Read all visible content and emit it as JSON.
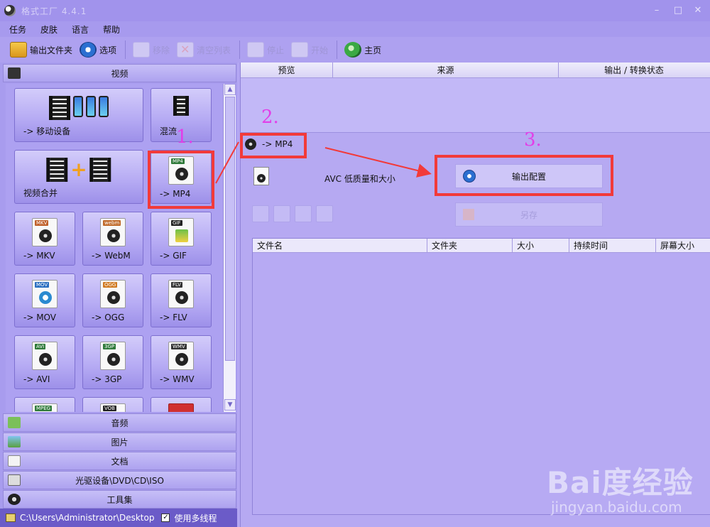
{
  "window": {
    "title": "格式工厂 4.4.1",
    "controls": [
      "–",
      "□",
      "✕"
    ]
  },
  "menu": [
    "任务",
    "皮肤",
    "语言",
    "帮助"
  ],
  "toolbar": {
    "output_folder": "输出文件夹",
    "options": "选项",
    "remove": "移除",
    "clear_list": "清空列表",
    "stop": "停止",
    "start": "开始",
    "home": "主页"
  },
  "left": {
    "video_header": "视频",
    "tiles": [
      {
        "label": "-> 移动设备"
      },
      {
        "label": "混流"
      },
      {
        "label": "视频合并"
      },
      {
        "label": "-> MP4",
        "badge": "MP4",
        "badge_color": "#2f7a3a"
      },
      {
        "label": "-> MKV",
        "badge": "MKV",
        "badge_color": "#c0602a"
      },
      {
        "label": "-> WebM",
        "badge": "webm",
        "badge_color": "#c06a2a"
      },
      {
        "label": "-> GIF",
        "badge": "GIF",
        "badge_color": "#222222"
      },
      {
        "label": "-> MOV",
        "badge": "MOV",
        "badge_color": "#2a6fc0"
      },
      {
        "label": "-> OGG",
        "badge": "OGG",
        "badge_color": "#d07a20"
      },
      {
        "label": "-> FLV",
        "badge": "FLV",
        "badge_color": "#333333"
      },
      {
        "label": "-> AVI",
        "badge": "AVI",
        "badge_color": "#2f7a3a"
      },
      {
        "label": "-> 3GP",
        "badge": "3GP",
        "badge_color": "#2f7a3a"
      },
      {
        "label": "-> WMV",
        "badge": "WMV",
        "badge_color": "#333333"
      },
      {
        "label": "",
        "badge": "MPEG",
        "badge_color": "#2f7a3a"
      },
      {
        "label": "",
        "badge": "VOB",
        "badge_color": "#222222"
      },
      {
        "label": "",
        "badge": "",
        "badge_color": "#d03030"
      }
    ],
    "categories": [
      "音频",
      "图片",
      "文档",
      "光驱设备\\DVD\\CD\\ISO",
      "工具集"
    ],
    "status_path": "C:\\Users\\Administrator\\Desktop",
    "multithread_label": "使用多线程",
    "multithread_checked": true
  },
  "task_table": {
    "columns": [
      "预览",
      "来源",
      "输出 / 转换状态"
    ]
  },
  "convert": {
    "profile_label": "-> MP4",
    "preset_text": "AVC 低质量和大小",
    "output_config": "输出配置",
    "save_label": "另存",
    "file_columns": [
      "文件名",
      "文件夹",
      "大小",
      "持续时间",
      "屏幕大小"
    ]
  },
  "annotations": {
    "step1": "1.",
    "step2": "2.",
    "step3": "3.",
    "color": "#f23a3a",
    "num_color": "#e23ee8"
  },
  "watermark": {
    "main": "Bai度经验",
    "sub": "jingyan.baidu.com"
  }
}
